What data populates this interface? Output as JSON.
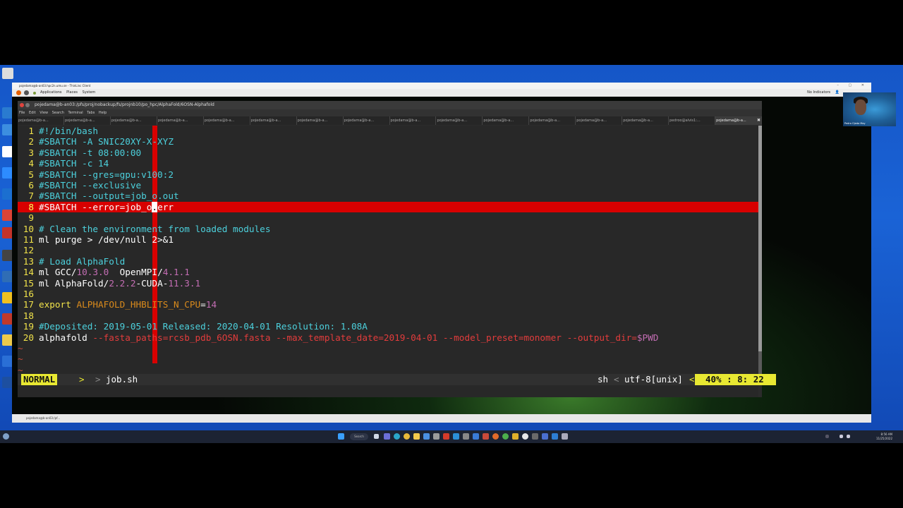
{
  "remote_window": {
    "title": "pojedama@b-an03.hpc2n.umu.se - ThinLinc Client",
    "panel_items": [
      "Applications",
      "Places",
      "System"
    ],
    "indicators": "No Indicators",
    "bottom_task": "pojedama@b-an03:/pf..."
  },
  "terminal": {
    "title": "pojedama@b-an03:/pfs/proj/nobackup/fs/projnb10/po_hpc/AlphaFold/6OSN-Alphafold",
    "menu": [
      "File",
      "Edit",
      "View",
      "Search",
      "Terminal",
      "Tabs",
      "Help"
    ],
    "tabs": [
      "pojedama@b-a...",
      "pojedama@b-a...",
      "pojedama@b-a...",
      "pojedama@b-a...",
      "pojedama@b-a...",
      "pojedama@b-a...",
      "pojedama@b-a...",
      "pojedama@b-a...",
      "pojedama@b-a...",
      "pojedama@b-a...",
      "pojedama@b-a...",
      "pojedama@b-a...",
      "pojedama@b-a...",
      "pojedama@b-a...",
      "pedroo@alvis1:...",
      "pojedama@b-a..."
    ],
    "active_tab_index": 15
  },
  "vim": {
    "lines": [
      {
        "n": "1",
        "segments": [
          [
            "#!/bin/bash",
            "cyan"
          ]
        ]
      },
      {
        "n": "2",
        "segments": [
          [
            "#SBATCH -A SNIC20XY-X-XYZ",
            "cyan"
          ]
        ]
      },
      {
        "n": "3",
        "segments": [
          [
            "#SBATCH -t 08:00:00",
            "cyan"
          ]
        ]
      },
      {
        "n": "4",
        "segments": [
          [
            "#SBATCH -c 14",
            "cyan"
          ]
        ]
      },
      {
        "n": "5",
        "segments": [
          [
            "#SBATCH --gres=gpu:v100:2",
            "cyan"
          ]
        ]
      },
      {
        "n": "6",
        "segments": [
          [
            "#SBATCH --exclusive",
            "cyan"
          ]
        ]
      },
      {
        "n": "7",
        "segments": [
          [
            "#SBATCH --output=job_o.out",
            "cyan"
          ]
        ]
      },
      {
        "n": "8",
        "segments": [
          [
            "#SBATCH --error=job_o",
            "white"
          ],
          [
            ".",
            "cursor"
          ],
          [
            "err",
            "white"
          ]
        ],
        "cursorline": true
      },
      {
        "n": "9",
        "segments": []
      },
      {
        "n": "10",
        "segments": [
          [
            "# Clean the environment from loaded modules",
            "cyan"
          ]
        ]
      },
      {
        "n": "11",
        "segments": [
          [
            "ml purge > /dev/null 2>&1",
            "white"
          ]
        ]
      },
      {
        "n": "12",
        "segments": []
      },
      {
        "n": "13",
        "segments": [
          [
            "# Load AlphaFold",
            "cyan"
          ]
        ]
      },
      {
        "n": "14",
        "segments": [
          [
            "ml GCC/",
            "white"
          ],
          [
            "10.3.0",
            "magenta"
          ],
          [
            "  OpenMPI/",
            "white"
          ],
          [
            "4.1.1",
            "magenta"
          ]
        ]
      },
      {
        "n": "15",
        "segments": [
          [
            "ml AlphaFold/",
            "white"
          ],
          [
            "2.2.2",
            "magenta"
          ],
          [
            "-CUDA-",
            "white"
          ],
          [
            "11.3.1",
            "magenta"
          ]
        ]
      },
      {
        "n": "16",
        "segments": []
      },
      {
        "n": "17",
        "segments": [
          [
            "export ",
            "yellow"
          ],
          [
            "ALPHAFOLD_HHBLITS_N_CPU",
            "orange"
          ],
          [
            "=",
            "white"
          ],
          [
            "14",
            "magenta"
          ]
        ]
      },
      {
        "n": "18",
        "segments": []
      },
      {
        "n": "19",
        "segments": [
          [
            "#Deposited: 2019-05-01 Released: 2020-04-01 Resolution: 1.08A",
            "cyan"
          ]
        ]
      },
      {
        "n": "20",
        "segments": [
          [
            "alphafold ",
            "white"
          ],
          [
            "--fasta_paths=rcsb_pdb_6OSN.fasta --max_template_date=2019-04-01 --model_preset=monomer --output_dir=",
            "red"
          ],
          [
            "$PWD",
            "magenta"
          ]
        ]
      }
    ],
    "tildes": [
      "~",
      "~",
      "~"
    ],
    "status": {
      "mode": "NORMAL",
      "mode_sep": ">",
      "file_sep": ">",
      "filename": "job.sh",
      "filetype": "sh",
      "ft_sep": "<",
      "encoding": "utf-8[unix]",
      "enc_sep": "<",
      "position": "40% :  8: 22"
    }
  },
  "taskbar": {
    "search": "Search",
    "time": "8:56 AM",
    "date": "11/25/2022"
  },
  "webcam": {
    "name": "Pedro Ojeda May"
  },
  "colors": {
    "cursorline": "#d80000",
    "status_accent": "#e8e832",
    "vim_bg": "#282828"
  }
}
